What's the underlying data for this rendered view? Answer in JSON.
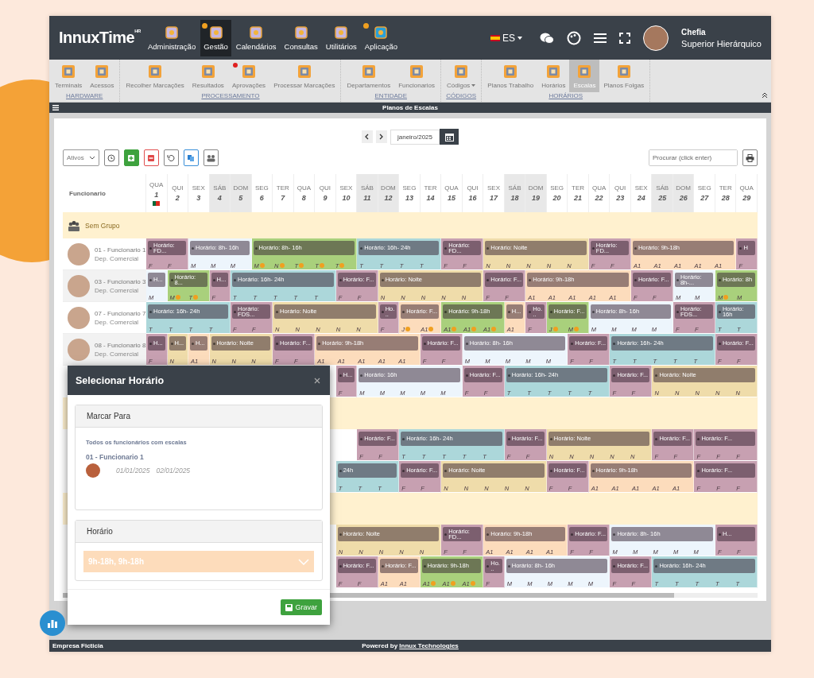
{
  "brand": {
    "name": "InnuxTime",
    "sup": "HR"
  },
  "nav": [
    {
      "label": "Administração",
      "selected": false,
      "alert": false
    },
    {
      "label": "Gestão",
      "selected": true,
      "alert": true
    },
    {
      "label": "Calendários",
      "selected": false,
      "alert": false
    },
    {
      "label": "Consultas",
      "selected": false,
      "alert": false
    },
    {
      "label": "Utilitários",
      "selected": false,
      "alert": false
    },
    {
      "label": "Aplicação",
      "selected": false,
      "alert": true
    }
  ],
  "language": "ES",
  "user": {
    "name": "Chefia",
    "role": "Superior Hierárquico"
  },
  "toolbar": [
    {
      "group": "HARDWARE",
      "items": [
        {
          "label": "Terminais",
          "selected": false,
          "alert": false
        },
        {
          "label": "Acessos",
          "selected": false,
          "alert": false
        }
      ]
    },
    {
      "group": "PROCESSAMENTO",
      "items": [
        {
          "label": "Recolher Marcações",
          "selected": false,
          "alert": false
        },
        {
          "label": "Resultados",
          "selected": false,
          "alert": false
        },
        {
          "label": "Aprovações",
          "selected": false,
          "alert": true
        },
        {
          "label": "Processar Marcações",
          "selected": false,
          "alert": false
        }
      ]
    },
    {
      "group": "ENTIDADE",
      "items": [
        {
          "label": "Departamentos",
          "selected": false,
          "alert": false
        },
        {
          "label": "Funcionarios",
          "selected": false,
          "alert": false
        }
      ]
    },
    {
      "group": "CÓDIGOS",
      "items": [
        {
          "label": "Códigos",
          "selected": false,
          "alert": false,
          "dropdown": true
        }
      ]
    },
    {
      "group": "HORÁRIOS",
      "items": [
        {
          "label": "Planos Trabalho",
          "selected": false,
          "alert": false
        },
        {
          "label": "Horários",
          "selected": false,
          "alert": false
        },
        {
          "label": "Escalas",
          "selected": true,
          "alert": false
        },
        {
          "label": "Planos Folgas",
          "selected": false,
          "alert": false
        }
      ]
    }
  ],
  "page_title": "Planos de Escalas",
  "month": "janeiro/2025",
  "filter": "Ativos",
  "search": {
    "placeholder": "Procurar (click enter)"
  },
  "table": {
    "first_column": "Funcionario",
    "days": [
      {
        "weekday": "QUA",
        "day": "1",
        "weekend": false,
        "holiday": true
      },
      {
        "weekday": "QUI",
        "day": "2",
        "weekend": false,
        "holiday": false
      },
      {
        "weekday": "SEX",
        "day": "3",
        "weekend": false,
        "holiday": false
      },
      {
        "weekday": "SÁB",
        "day": "4",
        "weekend": true,
        "holiday": false
      },
      {
        "weekday": "DOM",
        "day": "5",
        "weekend": true,
        "holiday": false
      },
      {
        "weekday": "SEG",
        "day": "6",
        "weekend": false,
        "holiday": false
      },
      {
        "weekday": "TER",
        "day": "7",
        "weekend": false,
        "holiday": false
      },
      {
        "weekday": "QUA",
        "day": "8",
        "weekend": false,
        "holiday": false
      },
      {
        "weekday": "QUI",
        "day": "9",
        "weekend": false,
        "holiday": false
      },
      {
        "weekday": "SEX",
        "day": "10",
        "weekend": false,
        "holiday": false
      },
      {
        "weekday": "SÁB",
        "day": "11",
        "weekend": true,
        "holiday": false
      },
      {
        "weekday": "DOM",
        "day": "12",
        "weekend": true,
        "holiday": false
      },
      {
        "weekday": "SEG",
        "day": "13",
        "weekend": false,
        "holiday": false
      },
      {
        "weekday": "TER",
        "day": "14",
        "weekend": false,
        "holiday": false
      },
      {
        "weekday": "QUA",
        "day": "15",
        "weekend": false,
        "holiday": false
      },
      {
        "weekday": "QUI",
        "day": "16",
        "weekend": false,
        "holiday": false
      },
      {
        "weekday": "SEX",
        "day": "17",
        "weekend": false,
        "holiday": false
      },
      {
        "weekday": "SÁB",
        "day": "18",
        "weekend": true,
        "holiday": false
      },
      {
        "weekday": "DOM",
        "day": "19",
        "weekend": true,
        "holiday": false
      },
      {
        "weekday": "SEG",
        "day": "20",
        "weekend": false,
        "holiday": false
      },
      {
        "weekday": "TER",
        "day": "21",
        "weekend": false,
        "holiday": false
      },
      {
        "weekday": "QUA",
        "day": "22",
        "weekend": false,
        "holiday": false
      },
      {
        "weekday": "QUI",
        "day": "23",
        "weekend": false,
        "holiday": false
      },
      {
        "weekday": "SEX",
        "day": "24",
        "weekend": false,
        "holiday": false
      },
      {
        "weekday": "SÁB",
        "day": "25",
        "weekend": true,
        "holiday": false
      },
      {
        "weekday": "DOM",
        "day": "26",
        "weekend": true,
        "holiday": false
      },
      {
        "weekday": "SEG",
        "day": "27",
        "weekend": false,
        "holiday": false
      },
      {
        "weekday": "TER",
        "day": "28",
        "weekend": false,
        "holiday": false
      },
      {
        "weekday": "QUA",
        "day": "29",
        "weekend": false,
        "holiday": false
      }
    ],
    "rows": [
      {
        "kind": "group",
        "label": "Sem Grupo"
      },
      {
        "kind": "employee",
        "name": "01 - Funcionario 1",
        "dept": "Dep. Comercial",
        "blocks": [
          {
            "label": "Horário: FD...",
            "color": "#c7a0b1",
            "days": [
              "F",
              "F"
            ]
          },
          {
            "label": "Horário: 8h- 16h",
            "color": "#edf5fc",
            "days": [
              "M",
              "M",
              "M"
            ]
          },
          {
            "label": "Horário: 8h- 16h",
            "color": "#a9d07c",
            "days": [
              "M",
              "N",
              "T",
              "T",
              "T"
            ],
            "alerts": [
              true,
              true,
              true,
              true,
              true
            ]
          },
          {
            "label": "Horário: 16h- 24h",
            "color": "#acd7da",
            "days": [
              "T",
              "T",
              "T",
              "T"
            ]
          },
          {
            "label": "Horário: FD...",
            "color": "#c7a0b1",
            "days": [
              "F",
              "F"
            ]
          },
          {
            "label": "Horário: Noite",
            "color": "#efdcaa",
            "days": [
              "N",
              "N",
              "N",
              "N",
              "N"
            ]
          },
          {
            "label": "Horário: FD...",
            "color": "#c7a0b1",
            "days": [
              "F",
              "F"
            ]
          },
          {
            "label": "Horário: 9h-18h",
            "color": "#fcdcbc",
            "days": [
              "A1",
              "A1",
              "A1",
              "A1",
              "A1"
            ]
          },
          {
            "label": "H",
            "color": "#c7a0b1",
            "days": [
              "F"
            ]
          }
        ]
      },
      {
        "kind": "employee",
        "name": "03 - Funcionario 3",
        "dept": "Dep. Comercial",
        "blocks": [
          {
            "label": "H...",
            "color": "#edf5fc",
            "days": [
              "M"
            ]
          },
          {
            "label": "Horário: 8...",
            "color": "#a9d07c",
            "days": [
              "M",
              "T"
            ],
            "alerts": [
              true,
              true
            ]
          },
          {
            "label": "H...",
            "color": "#c7a0b1",
            "days": [
              "F"
            ]
          },
          {
            "label": "Horário: 16h- 24h",
            "color": "#acd7da",
            "days": [
              "T",
              "T",
              "T",
              "T",
              "T"
            ]
          },
          {
            "label": "Horário: F...",
            "color": "#c7a0b1",
            "days": [
              "F",
              "F"
            ]
          },
          {
            "label": "Horário: Noite",
            "color": "#efdcaa",
            "days": [
              "N",
              "N",
              "N",
              "N",
              "N"
            ]
          },
          {
            "label": "Horário: F...",
            "color": "#c7a0b1",
            "days": [
              "F",
              "F"
            ]
          },
          {
            "label": "Horário: 9h-18h",
            "color": "#fcdcbc",
            "days": [
              "A1",
              "A1",
              "A1",
              "A1",
              "A1"
            ]
          },
          {
            "label": "Horário: F...",
            "color": "#c7a0b1",
            "days": [
              "F",
              "F"
            ]
          },
          {
            "label": "Horário: 8h-...",
            "color": "#edf5fc",
            "days": [
              "M",
              "M"
            ]
          },
          {
            "label": "Horário: 8h",
            "color": "#a9d07c",
            "days": [
              "M",
              "M"
            ],
            "alerts": [
              true,
              false
            ]
          }
        ]
      },
      {
        "kind": "employee",
        "name": "07 - Funcionario 7",
        "dept": "Dep. Comercial",
        "blocks": [
          {
            "label": "Horário: 16h- 24h",
            "color": "#acd7da",
            "days": [
              "T",
              "T",
              "T",
              "T"
            ]
          },
          {
            "label": "Horário: FDS...",
            "color": "#c7a0b1",
            "days": [
              "F",
              "F"
            ]
          },
          {
            "label": "Horário: Noite",
            "color": "#efdcaa",
            "days": [
              "N",
              "N",
              "N",
              "N",
              "N"
            ]
          },
          {
            "label": "Ho...",
            "color": "#c7a0b1",
            "days": [
              "F"
            ]
          },
          {
            "label": "Horário: F...",
            "color": "#fcdcbc",
            "days": [
              "J",
              "A1"
            ],
            "alerts": [
              true,
              true
            ]
          },
          {
            "label": "Horário: 9h-18h",
            "color": "#a9d07c",
            "days": [
              "A1",
              "A1",
              "A1"
            ],
            "alerts": [
              true,
              true,
              true
            ]
          },
          {
            "label": "H...",
            "color": "#fcdcbc",
            "days": [
              "A1"
            ]
          },
          {
            "label": "Ho...",
            "color": "#c7a0b1",
            "days": [
              "F"
            ]
          },
          {
            "label": "Horário: F...",
            "color": "#a9d07c",
            "days": [
              "J",
              "M"
            ],
            "alerts": [
              true,
              true
            ]
          },
          {
            "label": "Horário: 8h- 16h",
            "color": "#edf5fc",
            "days": [
              "M",
              "M",
              "M",
              "M"
            ]
          },
          {
            "label": "Horário: FDS...",
            "color": "#c7a0b1",
            "days": [
              "F",
              "F"
            ]
          },
          {
            "label": "Horário: 16h",
            "color": "#acd7da",
            "days": [
              "T",
              "T"
            ]
          }
        ]
      },
      {
        "kind": "employee",
        "name": "08 - Funcionario 8",
        "dept": "Dep. Comercial",
        "blocks": [
          {
            "label": "H...",
            "color": "#c7a0b1",
            "days": [
              "F"
            ]
          },
          {
            "label": "H...",
            "color": "#efdcaa",
            "days": [
              "N"
            ]
          },
          {
            "label": "H...",
            "color": "#fcdcbc",
            "days": [
              "A1"
            ]
          },
          {
            "label": "Horário: Noite",
            "color": "#efdcaa",
            "days": [
              "N",
              "N",
              "N"
            ]
          },
          {
            "label": "Horário: F...",
            "color": "#c7a0b1",
            "days": [
              "F",
              "F"
            ]
          },
          {
            "label": "Horário: 9h-18h",
            "color": "#fcdcbc",
            "days": [
              "A1",
              "A1",
              "A1",
              "A1",
              "A1"
            ]
          },
          {
            "label": "Horário: F...",
            "color": "#c7a0b1",
            "days": [
              "F",
              "F"
            ]
          },
          {
            "label": "Horário: 8h- 16h",
            "color": "#edf5fc",
            "days": [
              "M",
              "M",
              "M",
              "M",
              "M"
            ]
          },
          {
            "label": "Horário: F...",
            "color": "#c7a0b1",
            "days": [
              "F",
              "F"
            ]
          },
          {
            "label": "Horário: 16h- 24h",
            "color": "#acd7da",
            "days": [
              "T",
              "T",
              "T",
              "T",
              "T"
            ]
          },
          {
            "label": "Horário: F...",
            "color": "#c7a0b1",
            "days": [
              "F",
              "F"
            ]
          }
        ]
      },
      {
        "kind": "partial",
        "blocks": [
          {
            "label": "H...",
            "color": "#c7a0b1",
            "days": [
              "F"
            ]
          },
          {
            "label": "Horário: 16h",
            "color": "#edf5fc",
            "days": [
              "M",
              "M",
              "M",
              "M",
              "M"
            ]
          },
          {
            "label": "Horário: F...",
            "color": "#c7a0b1",
            "days": [
              "F",
              "F"
            ]
          },
          {
            "label": "Horário: 16h- 24h",
            "color": "#acd7da",
            "days": [
              "T",
              "T",
              "T",
              "T",
              "T"
            ]
          },
          {
            "label": "Horário: F...",
            "color": "#c7a0b1",
            "days": [
              "F",
              "F"
            ]
          },
          {
            "label": "Horário: Noite",
            "color": "#efdcaa",
            "days": [
              "N",
              "N",
              "N",
              "N",
              "N"
            ]
          }
        ]
      },
      {
        "kind": "group"
      },
      {
        "kind": "partial",
        "blocks": [
          {
            "label": "Horário: F...",
            "color": "#c7a0b1",
            "days": [
              "F",
              "F"
            ]
          },
          {
            "label": "Horário: 16h- 24h",
            "color": "#acd7da",
            "days": [
              "T",
              "T",
              "T",
              "T",
              "T"
            ]
          },
          {
            "label": "Horário: F...",
            "color": "#c7a0b1",
            "days": [
              "F",
              "F"
            ]
          },
          {
            "label": "Horário: Noite",
            "color": "#efdcaa",
            "days": [
              "N",
              "N",
              "N",
              "N",
              "N"
            ]
          },
          {
            "label": "Horário: F...",
            "color": "#c7a0b1",
            "days": [
              "F",
              "F"
            ]
          },
          {
            "label": "Horário: F...",
            "color": "#c7a0b1",
            "days": [
              "F",
              "F",
              "F"
            ]
          }
        ]
      },
      {
        "kind": "partial",
        "blocks": [
          {
            "label": "24h",
            "color": "#acd7da",
            "days": [
              "T",
              "T",
              "T"
            ]
          },
          {
            "label": "Horário: F...",
            "color": "#c7a0b1",
            "days": [
              "F",
              "F"
            ]
          },
          {
            "label": "Horário: Noite",
            "color": "#efdcaa",
            "days": [
              "N",
              "N",
              "N",
              "N",
              "N"
            ]
          },
          {
            "label": "Horário: F...",
            "color": "#c7a0b1",
            "days": [
              "F",
              "F"
            ]
          },
          {
            "label": "Horário: 9h-18h",
            "color": "#fcdcbc",
            "days": [
              "A1",
              "A1",
              "A1",
              "A1",
              "A1"
            ]
          },
          {
            "label": "Horário: F...",
            "color": "#c7a0b1",
            "days": [
              "F",
              "F",
              "F"
            ]
          }
        ]
      },
      {
        "kind": "group"
      },
      {
        "kind": "partial",
        "blocks": [
          {
            "label": "Horário: Noite",
            "color": "#efdcaa",
            "days": [
              "N",
              "N",
              "N",
              "N",
              "N"
            ]
          },
          {
            "label": "Horário: FD...",
            "color": "#c7a0b1",
            "days": [
              "F",
              "F"
            ]
          },
          {
            "label": "Horário: 9h-18h",
            "color": "#fcdcbc",
            "days": [
              "A1",
              "A1",
              "A1",
              "A1"
            ]
          },
          {
            "label": "Horário: F...",
            "color": "#c7a0b1",
            "days": [
              "F",
              "F"
            ]
          },
          {
            "label": "Horário: 8h- 16h",
            "color": "#edf5fc",
            "days": [
              "M",
              "M",
              "M",
              "M",
              "M"
            ]
          },
          {
            "label": "H...",
            "color": "#c7a0b1",
            "days": [
              "F",
              "F"
            ]
          }
        ]
      },
      {
        "kind": "partial",
        "blocks": [
          {
            "label": "Horário: F...",
            "color": "#c7a0b1",
            "days": [
              "F",
              "F"
            ]
          },
          {
            "label": "Horário: F...",
            "color": "#fcdcbc",
            "days": [
              "A1",
              "A1"
            ]
          },
          {
            "label": "Horário: 9h-18h",
            "color": "#a9d07c",
            "days": [
              "A1",
              "A1",
              "A1"
            ],
            "alerts": [
              true,
              true,
              true
            ]
          },
          {
            "label": "Ho...",
            "color": "#c7a0b1",
            "days": [
              "F"
            ]
          },
          {
            "label": "Horário: 8h- 16h",
            "color": "#edf5fc",
            "days": [
              "M",
              "M",
              "M",
              "M",
              "M"
            ]
          },
          {
            "label": "Horário: F...",
            "color": "#c7a0b1",
            "days": [
              "F",
              "F"
            ]
          },
          {
            "label": "Horário: 16h- 24h",
            "color": "#acd7da",
            "days": [
              "T",
              "T",
              "T",
              "T",
              "T"
            ]
          }
        ]
      }
    ]
  },
  "dialog": {
    "title": "Selecionar Horário",
    "section_1": "Marcar Para",
    "scope": "Todos os funcionários com escalas",
    "employee": "01 - Funcionario 1",
    "dates": [
      "01/01/2025",
      "02/01/2025"
    ],
    "section_2": "Horário",
    "schedule": "9h-18h, 9h-18h",
    "save": "Gravar"
  },
  "footer": {
    "company": "Empresa Ficticia",
    "powered": "Powered by",
    "link": "Innux Technologies"
  }
}
